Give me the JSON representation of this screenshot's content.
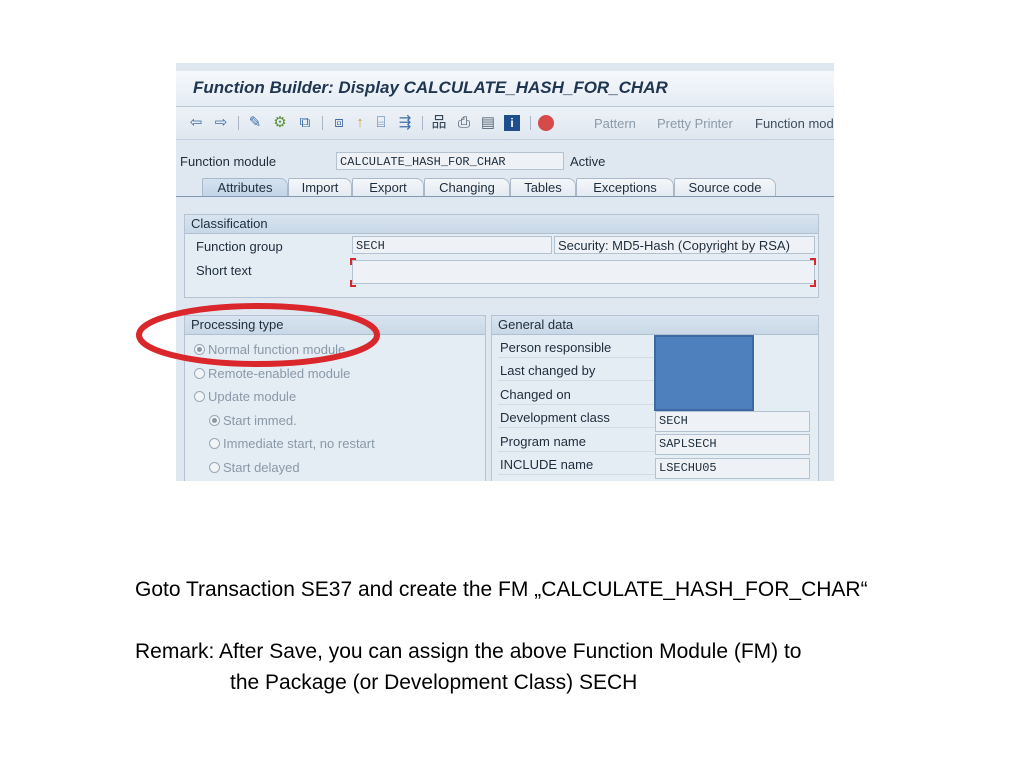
{
  "window": {
    "title": "Function Builder: Display CALCULATE_HASH_FOR_CHAR"
  },
  "toolbar": {
    "icons": [
      "back-arrow-icon",
      "forward-arrow-icon",
      "edit-pencil-icon",
      "other-object-icon",
      "check-icon",
      "where-used-icon",
      "hierarchy-icon",
      "enhance-icon",
      "display-object-list-icon",
      "info-icon",
      "stop-icon"
    ],
    "pattern": "Pattern",
    "pretty_printer": "Pretty Printer",
    "function_module": "Function mod"
  },
  "header": {
    "fm_label": "Function module",
    "fm_value": "CALCULATE_HASH_FOR_CHAR",
    "status": "Active"
  },
  "tabs": [
    "Attributes",
    "Import",
    "Export",
    "Changing",
    "Tables",
    "Exceptions",
    "Source code"
  ],
  "classification": {
    "title": "Classification",
    "function_group_label": "Function group",
    "function_group_value": "SECH",
    "function_group_desc": "Security: MD5-Hash (Copyright by RSA)",
    "short_text_label": "Short text",
    "short_text_value": ""
  },
  "processing": {
    "title": "Processing type",
    "options": [
      {
        "label": "Normal function module",
        "selected": true
      },
      {
        "label": "Remote-enabled module",
        "selected": false
      },
      {
        "label": "Update module",
        "selected": false
      }
    ],
    "sub_options": [
      {
        "label": "Start immed.",
        "selected": true
      },
      {
        "label": "Immediate start, no restart",
        "selected": false
      },
      {
        "label": "Start delayed",
        "selected": false
      }
    ]
  },
  "general": {
    "title": "General data",
    "rows": [
      {
        "label": "Person responsible",
        "value": ""
      },
      {
        "label": "Last changed by",
        "value": ""
      },
      {
        "label": "Changed on",
        "value": ""
      },
      {
        "label": "Development class",
        "value": "SECH"
      },
      {
        "label": "Program name",
        "value": "SAPLSECH"
      },
      {
        "label": "INCLUDE name",
        "value": "LSECHU05"
      }
    ]
  },
  "colors": {
    "annotation": "#d9272b",
    "redaction": "#4d80bd",
    "sap_background": "#dfe8f1"
  },
  "caption": {
    "line1": "Goto Transaction SE37 and create the FM „CALCULATE_HASH_FOR_CHAR“",
    "line2": "Remark: After Save, you can assign the above Function Module (FM) to",
    "line3": "the Package (or Development Class) SECH"
  }
}
